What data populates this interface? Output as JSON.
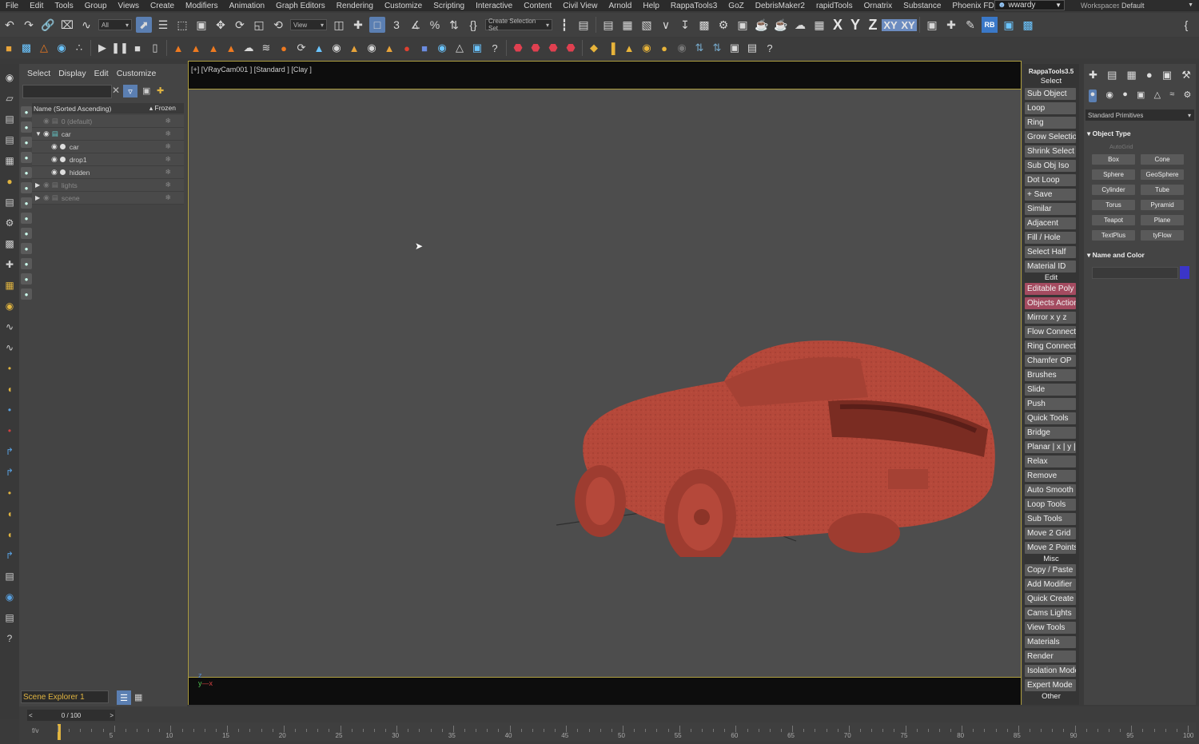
{
  "menu": [
    "File",
    "Edit",
    "Tools",
    "Group",
    "Views",
    "Create",
    "Modifiers",
    "Animation",
    "Graph Editors",
    "Rendering",
    "Customize",
    "Scripting",
    "Interactive",
    "Content",
    "Civil View",
    "Arnold",
    "Help",
    "RappaTools3",
    "GoZ",
    "DebrisMaker2",
    "rapidTools",
    "Ornatrix",
    "Substance",
    "Phoenix FD"
  ],
  "user": "wwardy",
  "workspaces_label": "Workspaces:",
  "workspaces_value": "Default",
  "toolbar": {
    "filter_all": "All",
    "ref_coord": "View",
    "selection_set": "Create Selection Set",
    "axes": [
      "X",
      "Y",
      "Z",
      "XY",
      "XY"
    ],
    "rb_label": "RB"
  },
  "scene_explorer": {
    "menu": [
      "Select",
      "Display",
      "Edit",
      "Customize"
    ],
    "col_name": "Name (Sorted Ascending)",
    "col_frozen": "▴ Frozen",
    "rows": [
      {
        "label": "0 (default)",
        "indent": 1,
        "dim": true
      },
      {
        "label": "car",
        "indent": 0,
        "dim": false
      },
      {
        "label": "car",
        "indent": 2,
        "dim": false
      },
      {
        "label": "drop1",
        "indent": 2,
        "dim": false
      },
      {
        "label": "hidden",
        "indent": 2,
        "dim": false
      },
      {
        "label": "lights",
        "indent": 0,
        "dim": true
      },
      {
        "label": "scene",
        "indent": 0,
        "dim": true
      }
    ],
    "explorer_name": "Scene Explorer 1"
  },
  "viewport": {
    "label": "[+] [VRayCam001 ] [Standard ] [Clay ]"
  },
  "rappa": {
    "title": "RappaTools3.5",
    "sections": [
      {
        "name": "Select",
        "items": [
          "Sub Object",
          "Loop",
          "Ring",
          "Grow Selection",
          "Shrink Select",
          "Sub Obj Iso",
          "Dot Loop",
          "+ Save",
          "Similar",
          "Adjacent",
          "Fill / Hole",
          "Select Half",
          "Material ID"
        ],
        "pink": []
      },
      {
        "name": "Edit",
        "items": [
          "Editable Poly",
          "Objects Actions",
          "Mirror   x   y   z",
          "Flow Connect",
          "Ring Connect",
          "Chamfer OP",
          "Brushes",
          "Slide",
          "Push",
          "Quick Tools",
          "Bridge",
          "Planar | x | y | z",
          "Relax",
          "Remove",
          "Auto Smooth",
          "Loop Tools",
          "Sub Tools",
          "Move 2 Grid",
          "Move 2 Points"
        ],
        "pink": [
          "Editable Poly",
          "Objects Actions"
        ]
      },
      {
        "name": "Misc",
        "items": [
          "Copy / Paste",
          "Add Modifier",
          "Quick Create",
          "Cams Lights",
          "View Tools",
          "Materials",
          "Render",
          "Isolation Mode",
          "Expert Mode"
        ],
        "pink": []
      },
      {
        "name": "Other",
        "items": [],
        "pink": []
      }
    ]
  },
  "command_panel": {
    "category": "Standard Primitives",
    "object_type": "Object Type",
    "autogrid": "AutoGrid",
    "primitives": [
      "Box",
      "Cone",
      "Sphere",
      "GeoSphere",
      "Cylinder",
      "Tube",
      "Torus",
      "Pyramid",
      "Teapot",
      "Plane",
      "TextPlus",
      "tyFlow"
    ],
    "name_and_color": "Name and Color",
    "color": "#3b35c8"
  },
  "timeline": {
    "frame_display": "0 / 100",
    "ticks": [
      "5",
      "10",
      "15",
      "20",
      "25",
      "30",
      "35",
      "40",
      "45",
      "50",
      "55",
      "60",
      "65",
      "70",
      "75",
      "80",
      "85",
      "90",
      "95",
      "100"
    ],
    "key_label": "f/v"
  }
}
